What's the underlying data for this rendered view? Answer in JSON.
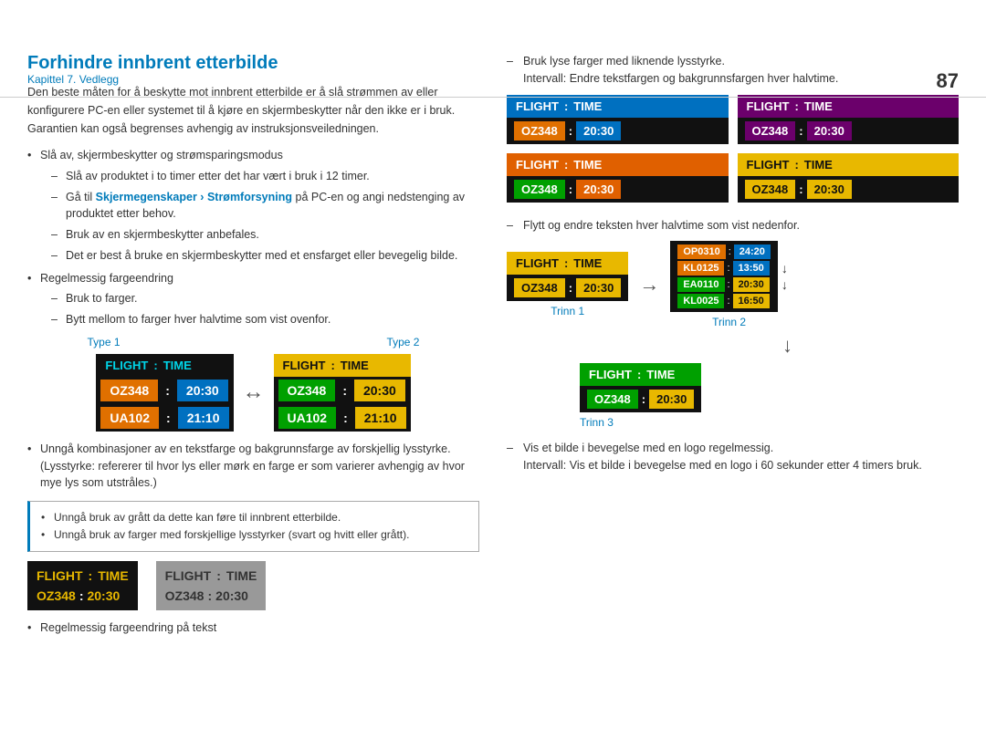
{
  "page": {
    "number": "87",
    "chapter": "Kapittel 7. Vedlegg"
  },
  "section": {
    "title": "Forhindre innbrent etterbilde",
    "intro": "Den beste måten for å beskytte mot innbrent etterbilde er å slå strømmen av eller konfigurere PC-en eller systemet til å kjøre en skjermbeskytter når den ikke er i bruk. Garantien kan også begrenses avhengig av instruksjonsveiledningen.",
    "bullets": [
      {
        "text": "Slå av, skjermbeskytter og strømsparingsmodus",
        "sub": [
          "Slå av produktet i to timer etter det har vært i bruk i 12 timer.",
          "Gå til Skjermegenskaper > Strømforsyning på PC-en og angi nedstenging av produktet etter behov.",
          "Bruk av en skjermbeskytter anbefales.",
          "Det er best å bruke en skjermbeskytter med et ensfarget eller bevegelig bilde."
        ],
        "hasLink": true,
        "linkText": "Skjermegenskaper › Strømforsyning"
      },
      {
        "text": "Regelmessig fargeendring",
        "sub": [
          "Bruk to farger.",
          "Bytt mellom to farger hver halvtime som vist ovenfor."
        ]
      }
    ],
    "type1_label": "Type 1",
    "type2_label": "Type 2",
    "warning_bullets": [
      "Unngå bruk av grått da dette kan føre til innbrent etterbilde.",
      "Unngå bruk av farger med forskjellige lysstyrker (svart og hvitt eller grått)."
    ],
    "bottom_bullet": "Regelmessig fargeendring på tekst",
    "avoid_bullet": "Unngå kombinasjoner av en tekstfarge og bakgrunnsfarge av forskjellig lysstyrke. (Lysstyrke: refererer til hvor lys eller mørk en farge er som varierer avhengig av hvor mye lys som utstråles.)"
  },
  "right": {
    "dash1": "Bruk lyse farger med liknende lysstyrke.",
    "dash1_interval": "Intervall: Endre tekstfargen og bakgrunnsfargen hver halvtime.",
    "dash2": "Flytt og endre teksten hver halvtime som vist nedenfor.",
    "dash2_interval": "",
    "trinn1_label": "Trinn 1",
    "trinn2_label": "Trinn 2",
    "trinn3_label": "Trinn 3",
    "dash3": "Vis et bilde i bevegelse med en logo regelmessig.",
    "dash3_interval": "Intervall: Vis et bilde i bevegelse med en logo i 60 sekunder etter 4 timers bruk."
  },
  "boards": {
    "flight": "FLIGHT",
    "colon": ":",
    "time": "TIME",
    "oz348": "OZ348",
    "colon2": ":",
    "t2030": "20:30",
    "ua102": "UA102",
    "t2110": "21:10"
  }
}
